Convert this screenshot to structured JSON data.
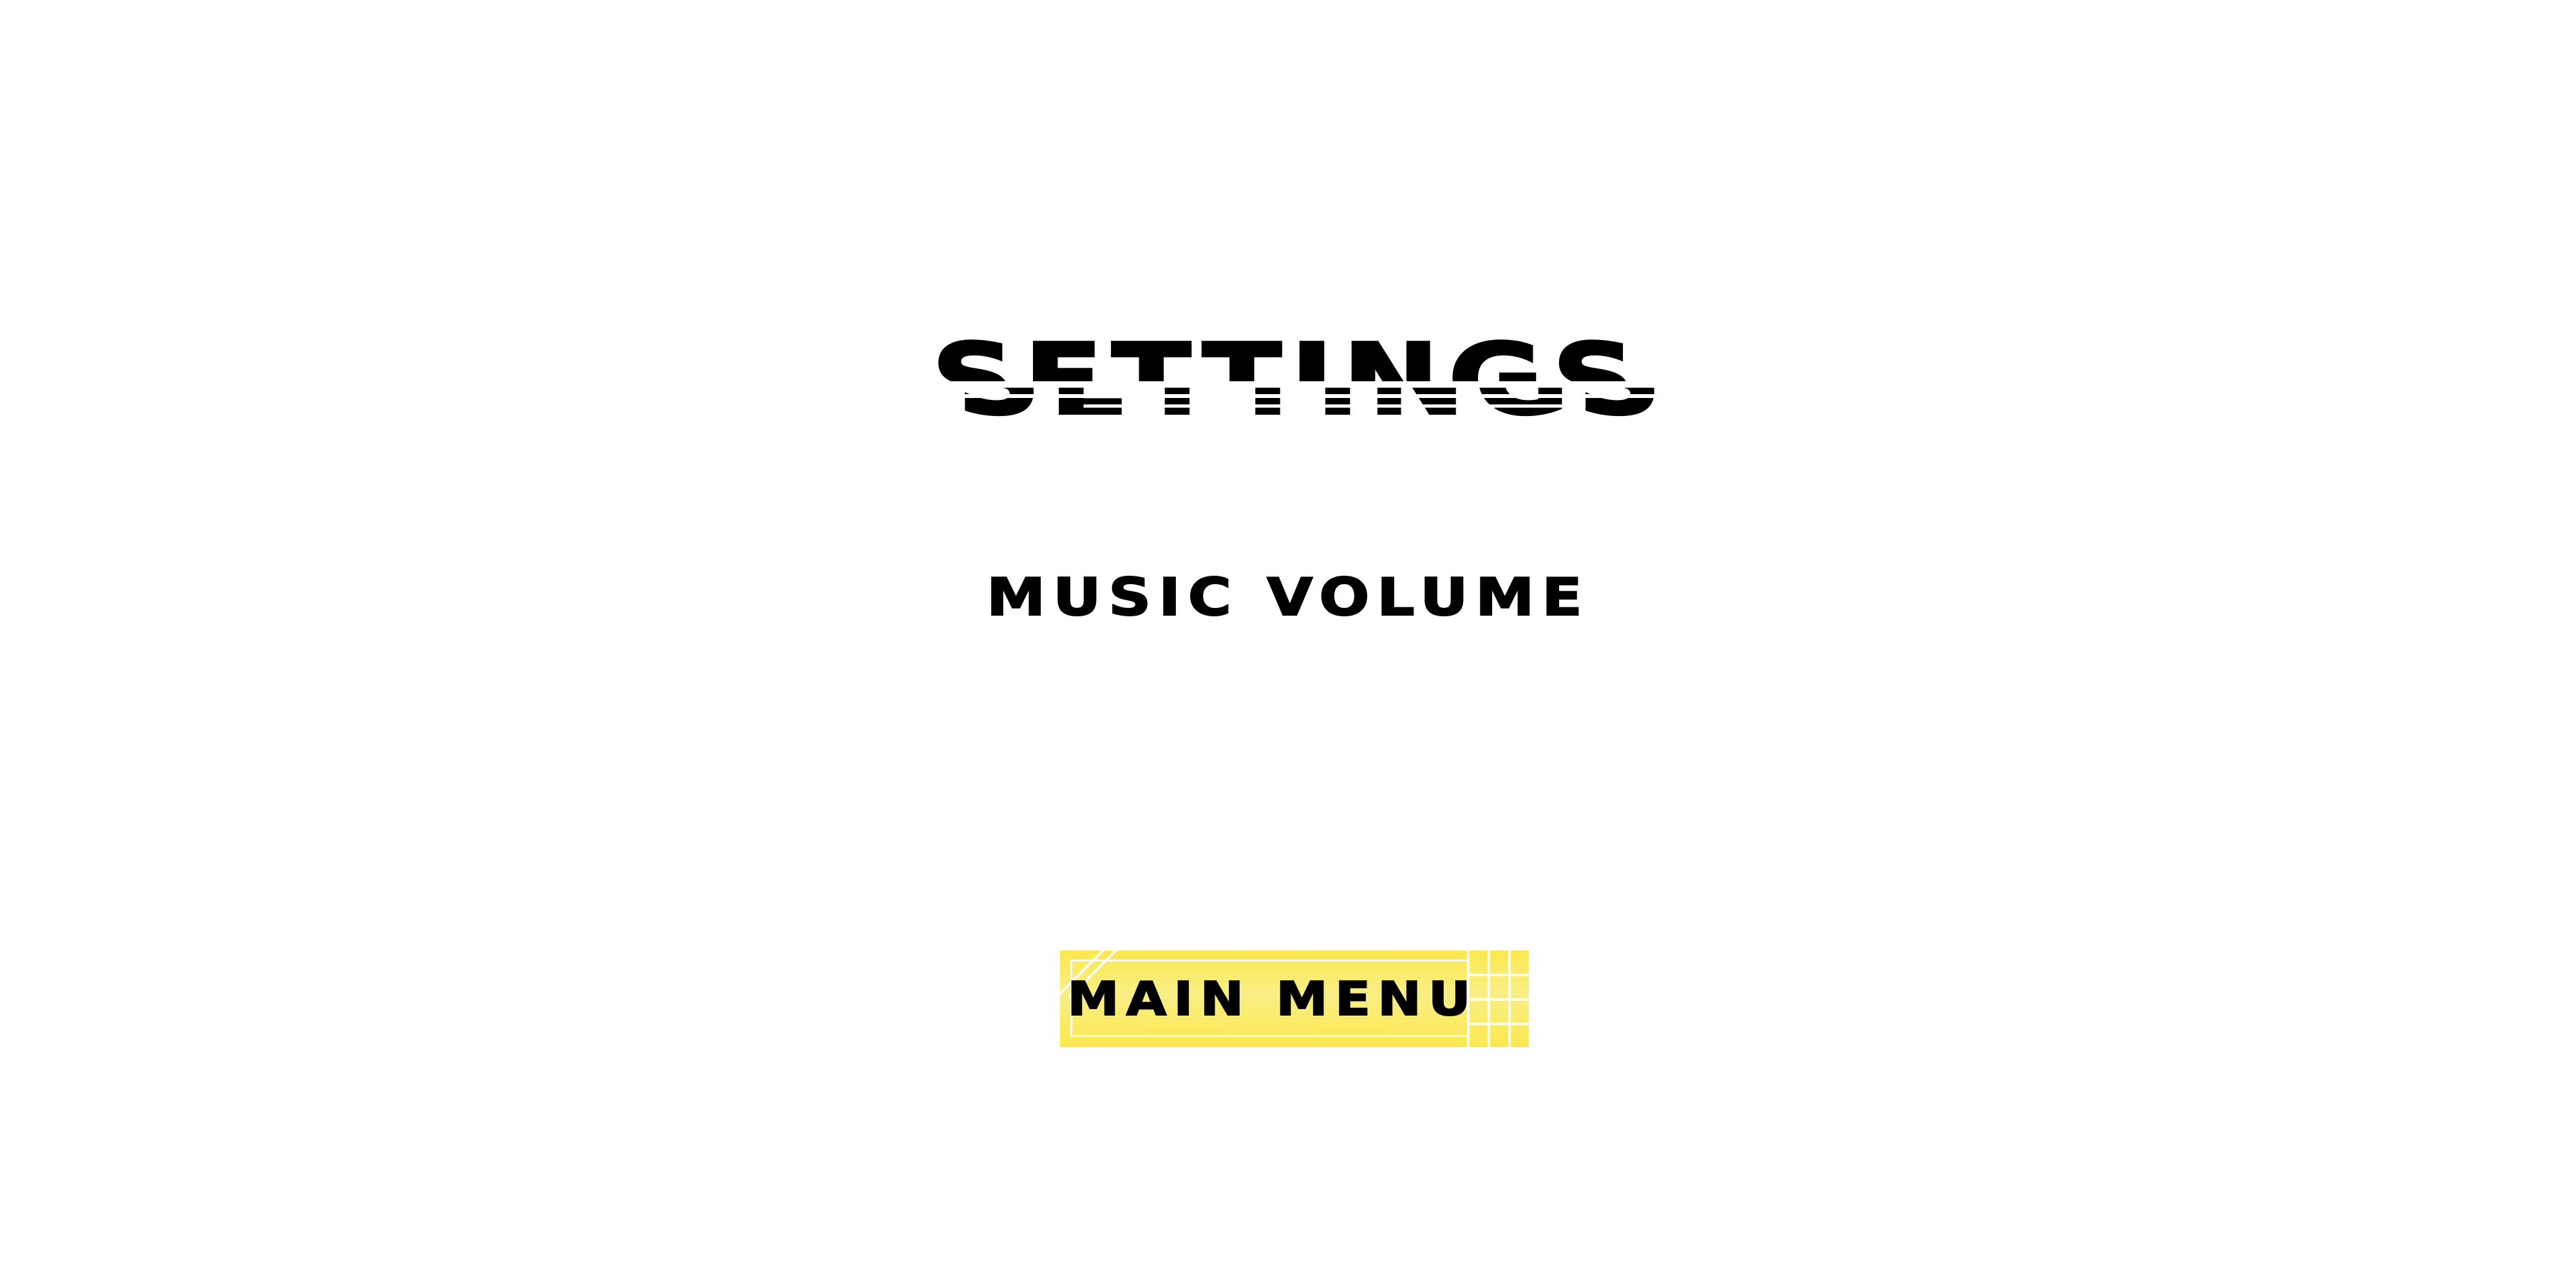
{
  "screen": {
    "title": "SETTINGS",
    "background_color": "#ffffff"
  },
  "music_volume": {
    "label": "MUSIC VOLUME"
  },
  "main_menu_button": {
    "label": "MAIN MENU",
    "color": "#fbe84e"
  }
}
